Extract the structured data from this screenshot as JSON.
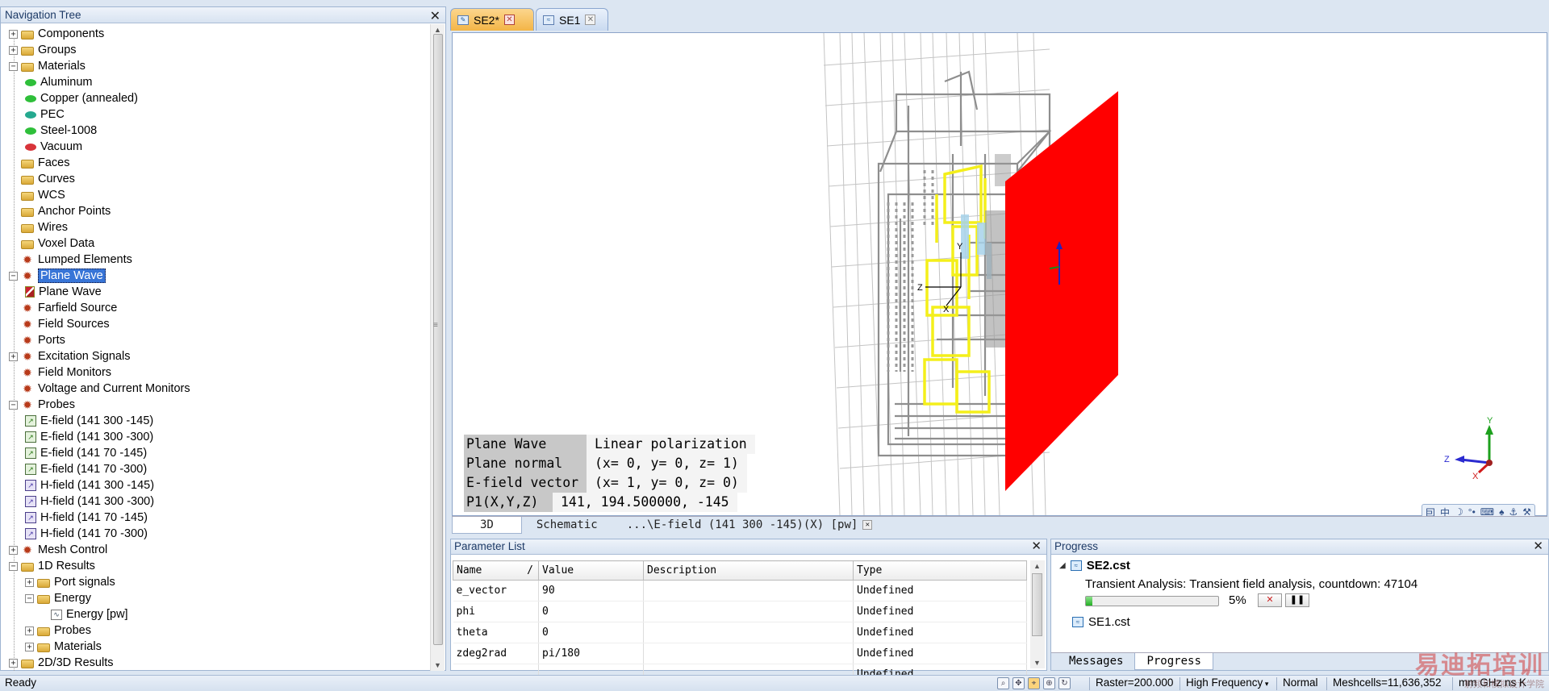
{
  "nav": {
    "title": "Navigation Tree",
    "items": [
      {
        "label": "Components",
        "exp": "+",
        "icon": "folder",
        "level": 0
      },
      {
        "label": "Groups",
        "exp": "+",
        "icon": "folder",
        "level": 0
      },
      {
        "label": "Materials",
        "exp": "-",
        "icon": "folder",
        "level": 0
      },
      {
        "label": "Aluminum",
        "icon": "material-green",
        "level": 1
      },
      {
        "label": "Copper (annealed)",
        "icon": "material-green",
        "level": 1
      },
      {
        "label": "PEC",
        "icon": "material-teal",
        "level": 1
      },
      {
        "label": "Steel-1008",
        "icon": "material-green",
        "level": 1
      },
      {
        "label": "Vacuum",
        "icon": "material-red",
        "level": 1
      },
      {
        "label": "Faces",
        "icon": "folder",
        "level": 0
      },
      {
        "label": "Curves",
        "icon": "folder",
        "level": 0
      },
      {
        "label": "WCS",
        "icon": "folder",
        "level": 0
      },
      {
        "label": "Anchor Points",
        "icon": "folder",
        "level": 0
      },
      {
        "label": "Wires",
        "icon": "folder",
        "level": 0
      },
      {
        "label": "Voxel Data",
        "icon": "folder",
        "level": 0
      },
      {
        "label": "Lumped Elements",
        "icon": "gear",
        "level": 0
      },
      {
        "label": "Plane Wave",
        "exp": "-",
        "icon": "gear",
        "level": 0,
        "selected": true
      },
      {
        "label": "Plane Wave",
        "icon": "plane-wave",
        "level": 1
      },
      {
        "label": "Farfield Source",
        "icon": "gear",
        "level": 0
      },
      {
        "label": "Field Sources",
        "icon": "gear",
        "level": 0
      },
      {
        "label": "Ports",
        "icon": "gear",
        "level": 0
      },
      {
        "label": "Excitation Signals",
        "exp": "+",
        "icon": "gear",
        "level": 0
      },
      {
        "label": "Field Monitors",
        "icon": "gear",
        "level": 0
      },
      {
        "label": "Voltage and Current Monitors",
        "icon": "gear",
        "level": 0
      },
      {
        "label": "Probes",
        "exp": "-",
        "icon": "gear",
        "level": 0
      },
      {
        "label": "E-field (141 300 -145)",
        "icon": "probe-e",
        "level": 1
      },
      {
        "label": "E-field (141 300 -300)",
        "icon": "probe-e",
        "level": 1
      },
      {
        "label": "E-field (141 70 -145)",
        "icon": "probe-e",
        "level": 1
      },
      {
        "label": "E-field (141 70 -300)",
        "icon": "probe-e",
        "level": 1
      },
      {
        "label": "H-field (141 300 -145)",
        "icon": "probe-h",
        "level": 1
      },
      {
        "label": "H-field (141 300 -300)",
        "icon": "probe-h",
        "level": 1
      },
      {
        "label": "H-field (141 70 -145)",
        "icon": "probe-h",
        "level": 1
      },
      {
        "label": "H-field (141 70 -300)",
        "icon": "probe-h",
        "level": 1
      },
      {
        "label": "Mesh Control",
        "exp": "+",
        "icon": "gear",
        "level": 0
      },
      {
        "label": "1D Results",
        "exp": "-",
        "icon": "folder",
        "level": 0
      },
      {
        "label": "Port signals",
        "exp": "+",
        "icon": "folder",
        "level": 1
      },
      {
        "label": "Energy",
        "exp": "-",
        "icon": "folder",
        "level": 1
      },
      {
        "label": "Energy [pw]",
        "icon": "chart",
        "level": 2
      },
      {
        "label": "Probes",
        "exp": "+",
        "icon": "folder",
        "level": 1
      },
      {
        "label": "Materials",
        "exp": "+",
        "icon": "folder",
        "level": 1
      },
      {
        "label": "2D/3D Results",
        "exp": "+",
        "icon": "folder",
        "level": 0
      }
    ]
  },
  "tabs": [
    {
      "label": "SE2*",
      "active": true
    },
    {
      "label": "SE1",
      "active": false
    }
  ],
  "view": {
    "info": [
      {
        "key": "Plane Wave",
        "value": "Linear polarization"
      },
      {
        "key": "Plane normal",
        "value": "(x= 0, y= 0, z= 1)"
      },
      {
        "key": "E-field vector",
        "value": "(x= 1, y= 0, z= 0)"
      },
      {
        "key": "P1(X,Y,Z)",
        "value": "141, 194.500000, -145"
      }
    ],
    "tabs": [
      "3D",
      "Schematic",
      "...\\E-field (141 300 -145)(X) [pw]"
    ],
    "axes": {
      "x": "X",
      "y": "Y",
      "z": "Z"
    },
    "toolbar_glyphs": [
      "囙",
      "中",
      "☽",
      "°•",
      "⌨",
      "♠",
      "⚓",
      "⚒"
    ]
  },
  "params": {
    "title": "Parameter List",
    "columns": [
      "Name",
      "/",
      "Value",
      "Description",
      "Type"
    ],
    "rows": [
      {
        "name": "e_vector",
        "value": "90",
        "description": "",
        "type": "Undefined"
      },
      {
        "name": "phi",
        "value": "0",
        "description": "",
        "type": "Undefined"
      },
      {
        "name": "theta",
        "value": "0",
        "description": "",
        "type": "Undefined"
      },
      {
        "name": "zdeg2rad",
        "value": "pi/180",
        "description": "",
        "type": "Undefined"
      },
      {
        "name": "",
        "value": "",
        "description": "",
        "type": "Undefined"
      }
    ]
  },
  "progress": {
    "title": "Progress",
    "job1": "SE2.cst",
    "job1_desc": "Transient Analysis: Transient field analysis, countdown: 47104",
    "percent_label": "5%",
    "percent": 5,
    "job2": "SE1.cst",
    "tabs": [
      "Messages",
      "Progress"
    ]
  },
  "status": {
    "ready": "Ready",
    "raster": "Raster=200.000",
    "frequency": "High Frequency",
    "mode": "Normal",
    "meshcells": "Meshcells=11,636,352",
    "units": "mm GHz ns K"
  },
  "watermark": {
    "text": "易迪拓培训",
    "sub": "射频和模拟设计学院"
  }
}
